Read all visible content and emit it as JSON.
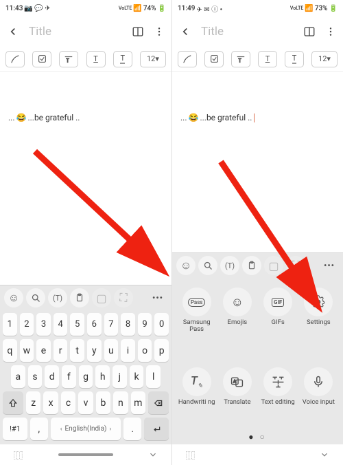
{
  "left": {
    "status": {
      "time": "11:43",
      "battery": "74%",
      "net": "VoLTE"
    },
    "header": {
      "title_placeholder": "Title"
    },
    "toolbar": {
      "fontsize": "12"
    },
    "note": {
      "prefix": "...",
      "emoji": "😂",
      "text": "...be grateful .."
    },
    "kbd": {
      "numbers": [
        "1",
        "2",
        "3",
        "4",
        "5",
        "6",
        "7",
        "8",
        "9",
        "0"
      ],
      "row1": [
        "q",
        "w",
        "e",
        "r",
        "t",
        "y",
        "u",
        "i",
        "o",
        "p"
      ],
      "row2": [
        "a",
        "s",
        "d",
        "f",
        "g",
        "h",
        "j",
        "k",
        "l"
      ],
      "row3": [
        "z",
        "x",
        "c",
        "v",
        "b",
        "n",
        "m"
      ],
      "sym": "!#1",
      "lang": "English(India)"
    }
  },
  "right": {
    "status": {
      "time": "11:49",
      "battery": "73%",
      "net": "VoLTE"
    },
    "header": {
      "title_placeholder": "Title"
    },
    "toolbar": {
      "fontsize": "12"
    },
    "note": {
      "prefix": "...",
      "emoji": "😂",
      "text": "...be grateful .."
    },
    "options": [
      {
        "icon": "pass",
        "label": "Samsung Pass"
      },
      {
        "icon": "emoji",
        "label": "Emojis"
      },
      {
        "icon": "gif",
        "label": "GIFs"
      },
      {
        "icon": "gear",
        "label": "Settings"
      },
      {
        "icon": "hand",
        "label": "Handwriti\nng"
      },
      {
        "icon": "trans",
        "label": "Translate"
      },
      {
        "icon": "textedit",
        "label": "Text editing"
      },
      {
        "icon": "mic",
        "label": "Voice input"
      }
    ]
  }
}
